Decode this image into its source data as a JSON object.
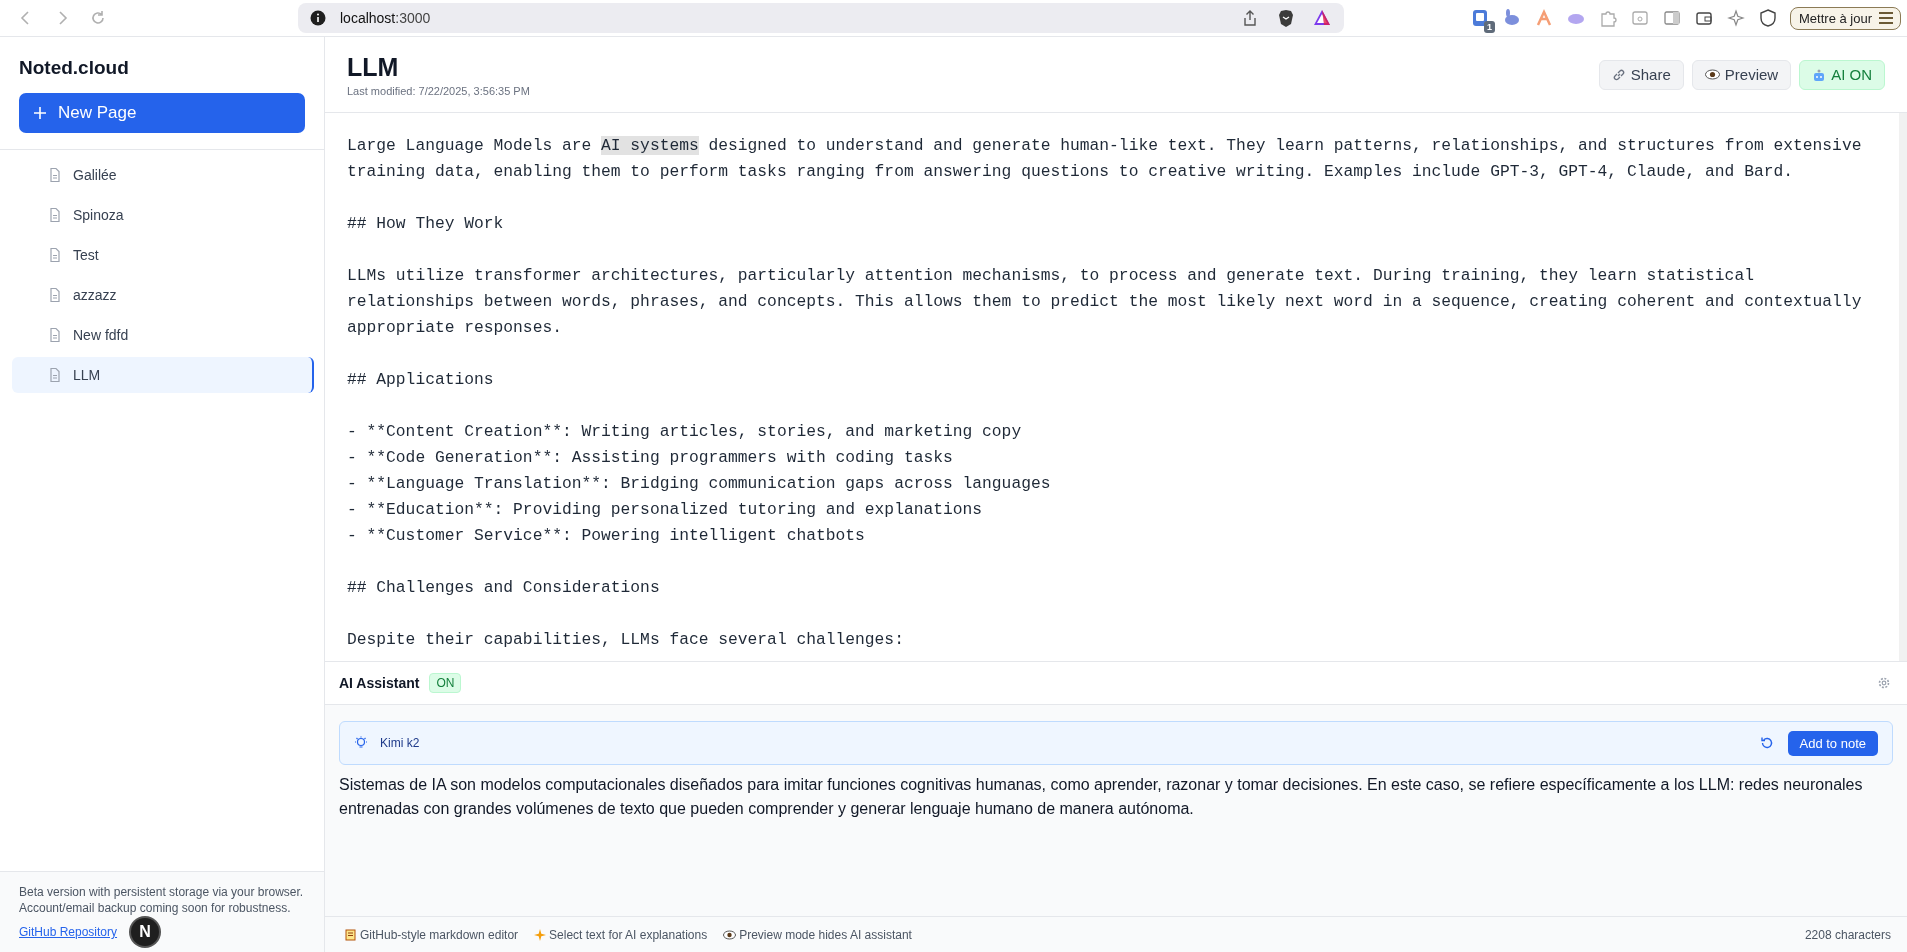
{
  "browser": {
    "url_host": "localhost",
    "url_port": ":3000",
    "extension_badge": "1",
    "update_button": "Mettre à jour"
  },
  "sidebar": {
    "app_name": "Noted.cloud",
    "new_page_button": "New Page",
    "pages": [
      {
        "title": "Galilée",
        "selected": false
      },
      {
        "title": "Spinoza",
        "selected": false
      },
      {
        "title": "Test",
        "selected": false
      },
      {
        "title": "azzazz",
        "selected": false
      },
      {
        "title": "New fdfd",
        "selected": false
      },
      {
        "title": "LLM",
        "selected": true
      }
    ],
    "footer_note": "Beta version with persistent storage via your browser. Account/email backup coming soon for robustness.",
    "repo_link": "GitHub Repository",
    "dev_badge": "N"
  },
  "page": {
    "title": "LLM",
    "last_modified": "Last modified: 7/22/2025, 3:56:35 PM",
    "actions": [
      {
        "kind": "share",
        "label": "Share"
      },
      {
        "kind": "preview",
        "label": "Preview"
      },
      {
        "kind": "ai",
        "label": "AI ON"
      }
    ]
  },
  "editor": {
    "blocks": [
      {
        "kind": "paragraph",
        "segments": [
          {
            "text": "Large Language Models are ",
            "selected": false
          },
          {
            "text": "AI systems",
            "selected": true
          },
          {
            "text": " designed to understand and generate human-like text. They learn patterns, relationships, and structures from extensive training data, enabling them to perform tasks ranging from answering questions to creative writing. Examples include GPT-3, GPT-4, Claude, and Bard.",
            "selected": false
          }
        ]
      },
      {
        "kind": "lines",
        "lines": [
          "## How They Work"
        ]
      },
      {
        "kind": "lines",
        "lines": [
          "LLMs utilize transformer architectures, particularly attention mechanisms, to process and generate text. During training, they learn statistical relationships between words, phrases, and concepts. This allows them to predict the most likely next word in a sequence, creating coherent and contextually appropriate responses."
        ]
      },
      {
        "kind": "lines",
        "lines": [
          "## Applications"
        ]
      },
      {
        "kind": "lines",
        "lines": [
          "- **Content Creation**: Writing articles, stories, and marketing copy",
          "- **Code Generation**: Assisting programmers with coding tasks",
          "- **Language Translation**: Bridging communication gaps across languages",
          "- **Education**: Providing personalized tutoring and explanations",
          "- **Customer Service**: Powering intelligent chatbots"
        ]
      },
      {
        "kind": "lines",
        "lines": [
          "## Challenges and Considerations"
        ]
      },
      {
        "kind": "lines",
        "lines": [
          "Despite their capabilities, LLMs face several challenges:"
        ]
      }
    ]
  },
  "assistant": {
    "title": "AI Assistant",
    "status": "ON",
    "model": "Kimi k2",
    "add_button": "Add to note",
    "answer": "Sistemas de IA son modelos computacionales diseñados para imitar funciones cognitivas humanas, como aprender, razonar y tomar decisiones. En este caso, se refiere específicamente a los LLM: redes neuronales entrenadas con grandes volúmenes de texto que pueden comprender y generar lenguaje humano de manera autónoma."
  },
  "status_bar": {
    "hints": [
      {
        "kind": "memo",
        "text": "GitHub-style markdown editor"
      },
      {
        "kind": "sparkle",
        "text": "Select text for AI explanations"
      },
      {
        "kind": "eye",
        "text": "Preview mode hides AI assistant"
      }
    ],
    "char_count": "2208 characters"
  }
}
